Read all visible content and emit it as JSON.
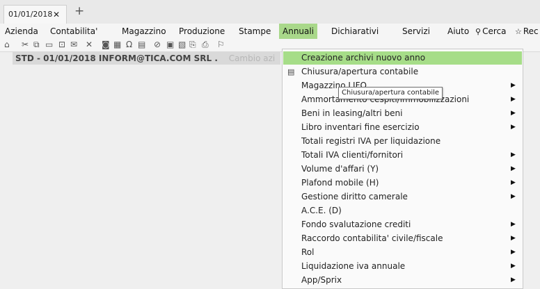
{
  "tab": {
    "label": "01/01/2018",
    "close": "✕",
    "add": "+"
  },
  "menu": {
    "items": [
      "Azienda",
      "Contabilita'",
      "Magazzino",
      "Produzione",
      "Stampe",
      "Annuali",
      "Dichiarativi",
      "Servizi",
      "Aiuto",
      "Cerca",
      "Rec"
    ],
    "active": "Annuali"
  },
  "toolbar": {
    "icons": [
      "home-icon",
      "tools-icon",
      "copy-icon",
      "page-icon",
      "layout-icon",
      "chat-icon",
      "cross-icon",
      "camera-icon",
      "grid-icon",
      "omega-icon",
      "calc-icon",
      "help-icon",
      "archive-icon",
      "document-icon",
      "export-icon",
      "print-icon",
      "flag-icon"
    ]
  },
  "status": {
    "company": "STD - 01/01/2018  INFORM@TICA.COM SRL .",
    "change": "Cambio azi"
  },
  "dropdown": {
    "items": [
      "Creazione archivi nuovo anno",
      "Chiusura/apertura contabile",
      "Magazzino LIFO",
      "Ammortamento cespiti/immobilizzazioni",
      "Beni in leasing/altri beni",
      "Libro inventari fine esercizio",
      "Totali registri IVA per liquidazione",
      "Totali IVA clienti/fornitori",
      "Volume d'affari (Y)",
      "Plafond mobile (H)",
      "Gestione diritto camerale",
      "A.C.E. (D)",
      "Fondo svalutazione crediti",
      "Raccordo contabilita' civile/fiscale",
      "Rol",
      "Liquidazione iva annuale",
      "App/Sprix"
    ],
    "highlighted": "Creazione archivi nuovo anno"
  },
  "tooltip": "Chiusura/apertura contabile",
  "colors": {
    "highlight": "#a6dd88",
    "menu_active": "#a9d88a",
    "background": "#efefef"
  }
}
